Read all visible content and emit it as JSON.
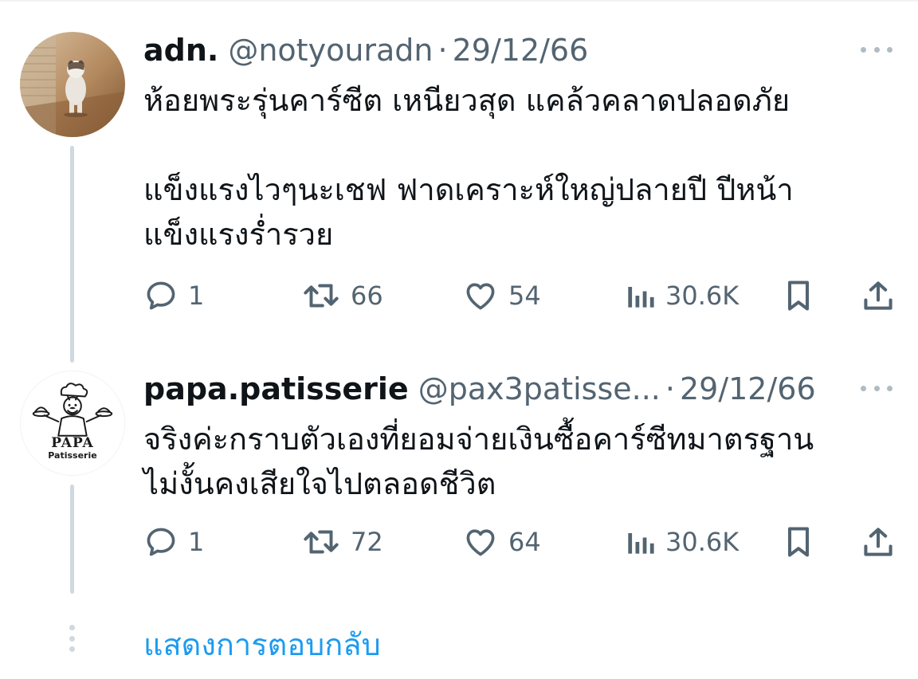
{
  "tweets": [
    {
      "name": "adn.",
      "handle": "@notyouradn",
      "separator": "·",
      "date": "29/12/66",
      "text_lines": [
        "ห้อยพระรุ่นคาร์ซีต เหนียวสุด แคล้วคลาดปลอดภัย",
        "",
        "แข็งแรงไวๆนะเชฟ ฟาดเคราะห์ใหญ่ปลายปี ปีหน้า",
        "แข็งแรงร่ำรวย"
      ],
      "stats": {
        "replies": "1",
        "retweets": "66",
        "likes": "54",
        "views": "30.6K"
      },
      "avatar_icon": "cat-photo-avatar"
    },
    {
      "name": "papa.patisserie",
      "handle": "@pax3patisse...",
      "separator": "·",
      "date": "29/12/66",
      "text_lines": [
        "จริงค่ะกราบตัวเองที่ยอมจ่ายเงินซื้อคาร์ซีทมาตรฐาน",
        "ไม่งั้นคงเสียใจไปตลอดชีวิต"
      ],
      "stats": {
        "replies": "1",
        "retweets": "72",
        "likes": "64",
        "views": "30.6K"
      },
      "avatar": {
        "logo_text": "PAPA",
        "logo_subtext": "Patisserie"
      }
    }
  ],
  "show_replies_label": "แสดงการตอบกลับ",
  "icons": {
    "reply": "reply-bubble-icon",
    "retweet": "retweet-icon",
    "like": "heart-icon",
    "views": "views-bar-chart-icon",
    "bookmark": "bookmark-icon",
    "share": "share-upload-icon",
    "more": "more-dots-icon"
  },
  "colors": {
    "text": "#0f1419",
    "secondary": "#536471",
    "link": "#1d9bf0",
    "thread_line": "#cfd9de"
  }
}
